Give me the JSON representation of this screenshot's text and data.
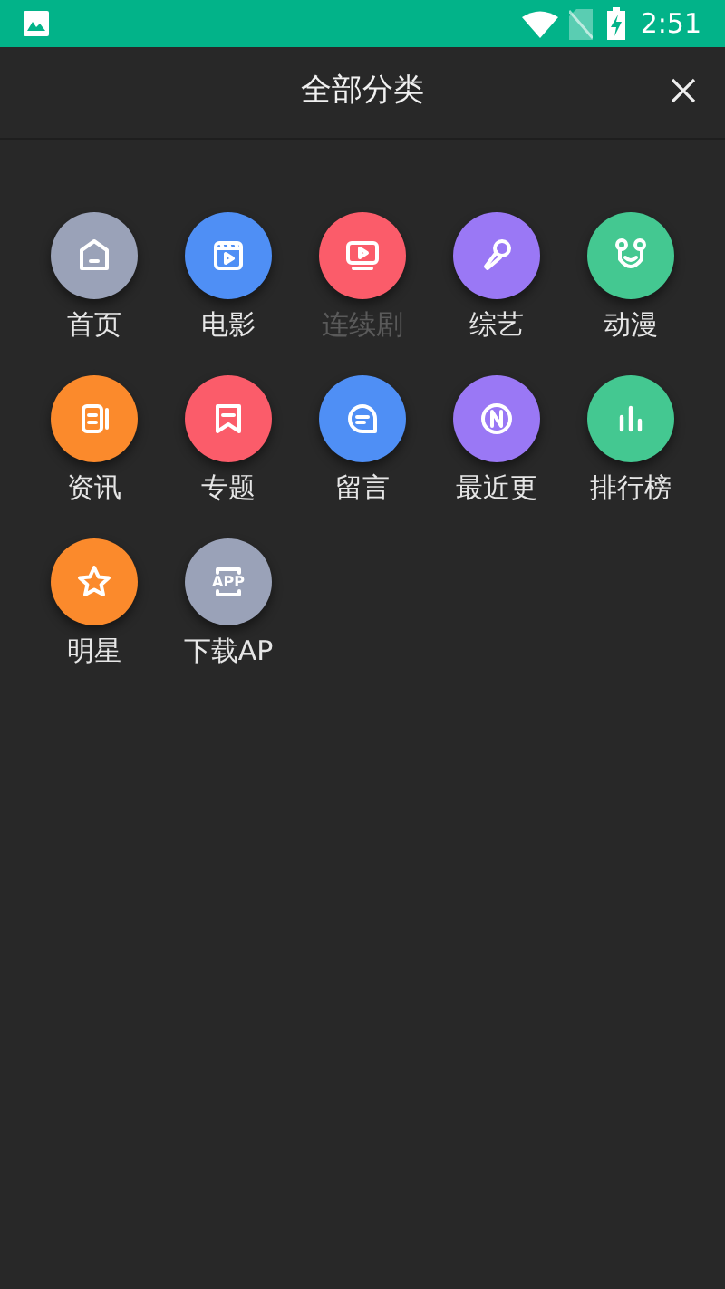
{
  "status_bar": {
    "time": "2:51"
  },
  "header": {
    "title": "全部分类"
  },
  "categories": [
    {
      "label": "首页",
      "kind": "home",
      "color": "#9aa2b8",
      "dimmed": false
    },
    {
      "label": "电影",
      "kind": "film",
      "color": "#4f8ff5",
      "dimmed": false
    },
    {
      "label": "连续剧",
      "kind": "tv",
      "color": "#fb5c6a",
      "dimmed": true
    },
    {
      "label": "综艺",
      "kind": "mic",
      "color": "#9a78f5",
      "dimmed": false
    },
    {
      "label": "动漫",
      "kind": "bear",
      "color": "#44c891",
      "dimmed": false
    },
    {
      "label": "资讯",
      "kind": "news",
      "color": "#fb8a2c",
      "dimmed": false
    },
    {
      "label": "专题",
      "kind": "bookmark",
      "color": "#fb5c6a",
      "dimmed": false
    },
    {
      "label": "留言",
      "kind": "chat",
      "color": "#4f8ff5",
      "dimmed": false
    },
    {
      "label": "最近更",
      "kind": "new",
      "color": "#9a78f5",
      "dimmed": false
    },
    {
      "label": "排行榜",
      "kind": "chart",
      "color": "#44c891",
      "dimmed": false
    },
    {
      "label": "明星",
      "kind": "star",
      "color": "#fb8a2c",
      "dimmed": false
    },
    {
      "label": "下载AP",
      "kind": "app",
      "color": "#9aa2b8",
      "dimmed": false,
      "icon_text": "APP"
    }
  ]
}
